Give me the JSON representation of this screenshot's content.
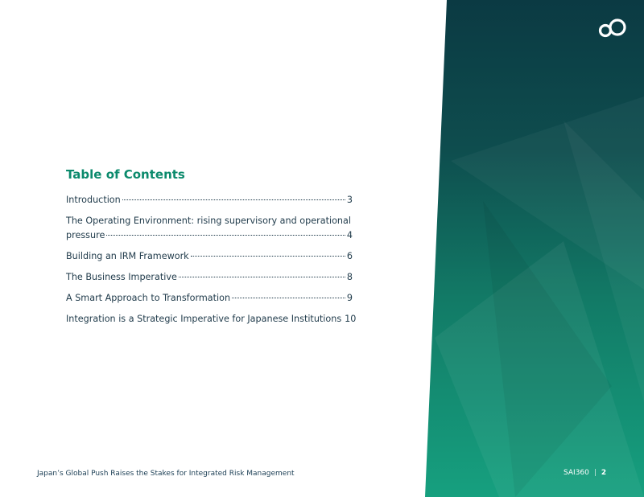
{
  "toc": {
    "title": "Table of Contents",
    "entries": [
      {
        "text": "Introduction",
        "page": "3"
      },
      {
        "text_line1": "The Operating Environment: rising supervisory and operational",
        "text_line2": "pressure",
        "page": "4"
      },
      {
        "text": "Building an IRM Framework",
        "page": "6"
      },
      {
        "text": "The Business Imperative",
        "page": "8"
      },
      {
        "text": "A Smart Approach to Transformation",
        "page": "9"
      },
      {
        "text": "Integration is a Strategic Imperative for Japanese Institutions",
        "page": "10"
      }
    ]
  },
  "footer": {
    "document_title": "Japan’s Global Push Raises the Stakes for Integrated Risk Management",
    "brand": "SAI360",
    "separator": "|",
    "page_number": "2"
  },
  "colors": {
    "heading_green": "#0b8a6c",
    "panel_top": "#0b3a43",
    "panel_bottom": "#16a07f",
    "text_dark": "#1f3a4a"
  },
  "icons": {
    "logo": "sai360-infinity-logo"
  }
}
